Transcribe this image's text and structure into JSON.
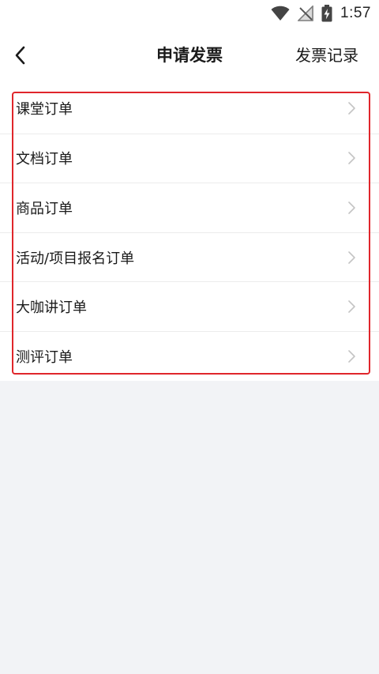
{
  "status_bar": {
    "time": "1:57",
    "icons": [
      "wifi-icon",
      "no-signal-icon",
      "battery-charging-icon"
    ]
  },
  "header": {
    "back_icon": "chevron-left-icon",
    "title": "申请发票",
    "records_label": "发票记录"
  },
  "orders": [
    {
      "label": "课堂订单"
    },
    {
      "label": "文档订单"
    },
    {
      "label": "商品订单"
    },
    {
      "label": "活动/项目报名订单"
    },
    {
      "label": "大咖讲订单"
    },
    {
      "label": "测评订单"
    }
  ],
  "colors": {
    "highlight": "#e0262b",
    "background": "#f2f3f6",
    "chevron": "#c4c4c4"
  }
}
